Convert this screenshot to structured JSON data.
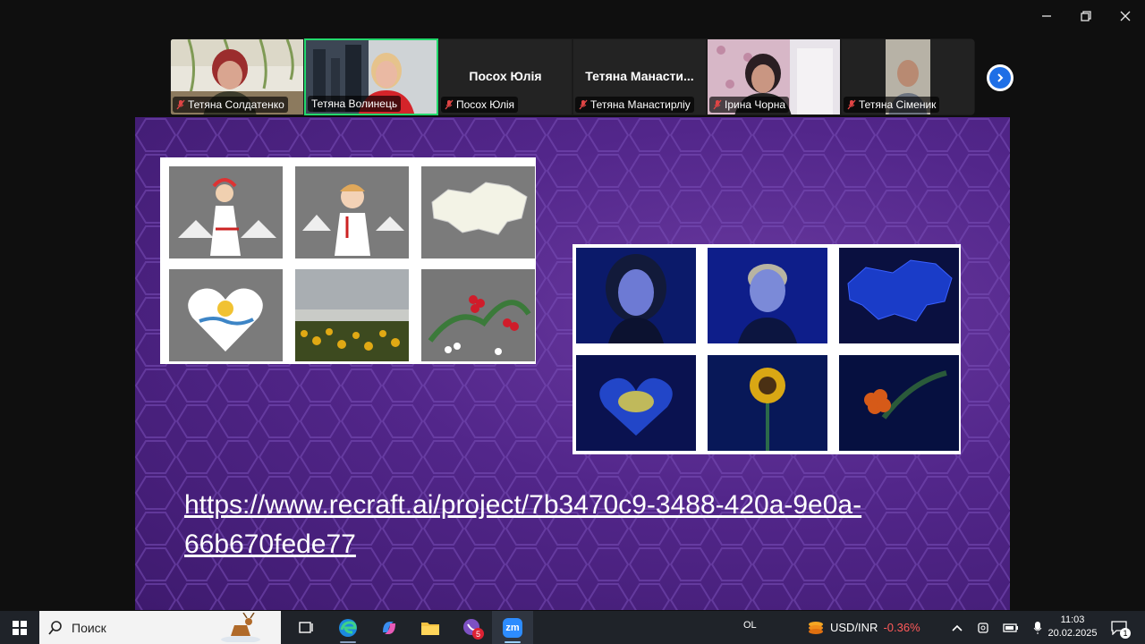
{
  "window": {
    "controls": [
      "minimize-icon",
      "restore-icon",
      "close-icon"
    ]
  },
  "participants": [
    {
      "name": "Тетяна Солдатенко",
      "video": true,
      "muted": true,
      "active": false
    },
    {
      "name": "Тетяна Волинець",
      "video": true,
      "muted": false,
      "active": true
    },
    {
      "name": "Посох Юлія",
      "display_name": "Посох Юлія",
      "video": false,
      "muted": true,
      "active": false
    },
    {
      "name": "Тетяна Манастирліу",
      "display_name": "Тетяна  Манасти...",
      "video": false,
      "muted": true,
      "active": false
    },
    {
      "name": "Ірина Чорна",
      "video": true,
      "muted": true,
      "active": false
    },
    {
      "name": "Тетяна Сіменик",
      "video": true,
      "muted": true,
      "active": false
    }
  ],
  "slide": {
    "link_line1": "https://www.recraft.ai/project/7b3470c9-3488-420a-9e0a-",
    "link_line2": "66b670fede77",
    "colors": {
      "background": "#52268a",
      "hex_pattern": "#7a4fb8"
    }
  },
  "taskbar": {
    "search_placeholder": "Поиск",
    "ime": "OL",
    "ticker_symbol": "USD/INR",
    "ticker_change": "-0.36%",
    "time": "11:03",
    "date": "20.02.2025",
    "viber_badge": "5",
    "notification_count": "1",
    "zoom_label": "zm"
  }
}
